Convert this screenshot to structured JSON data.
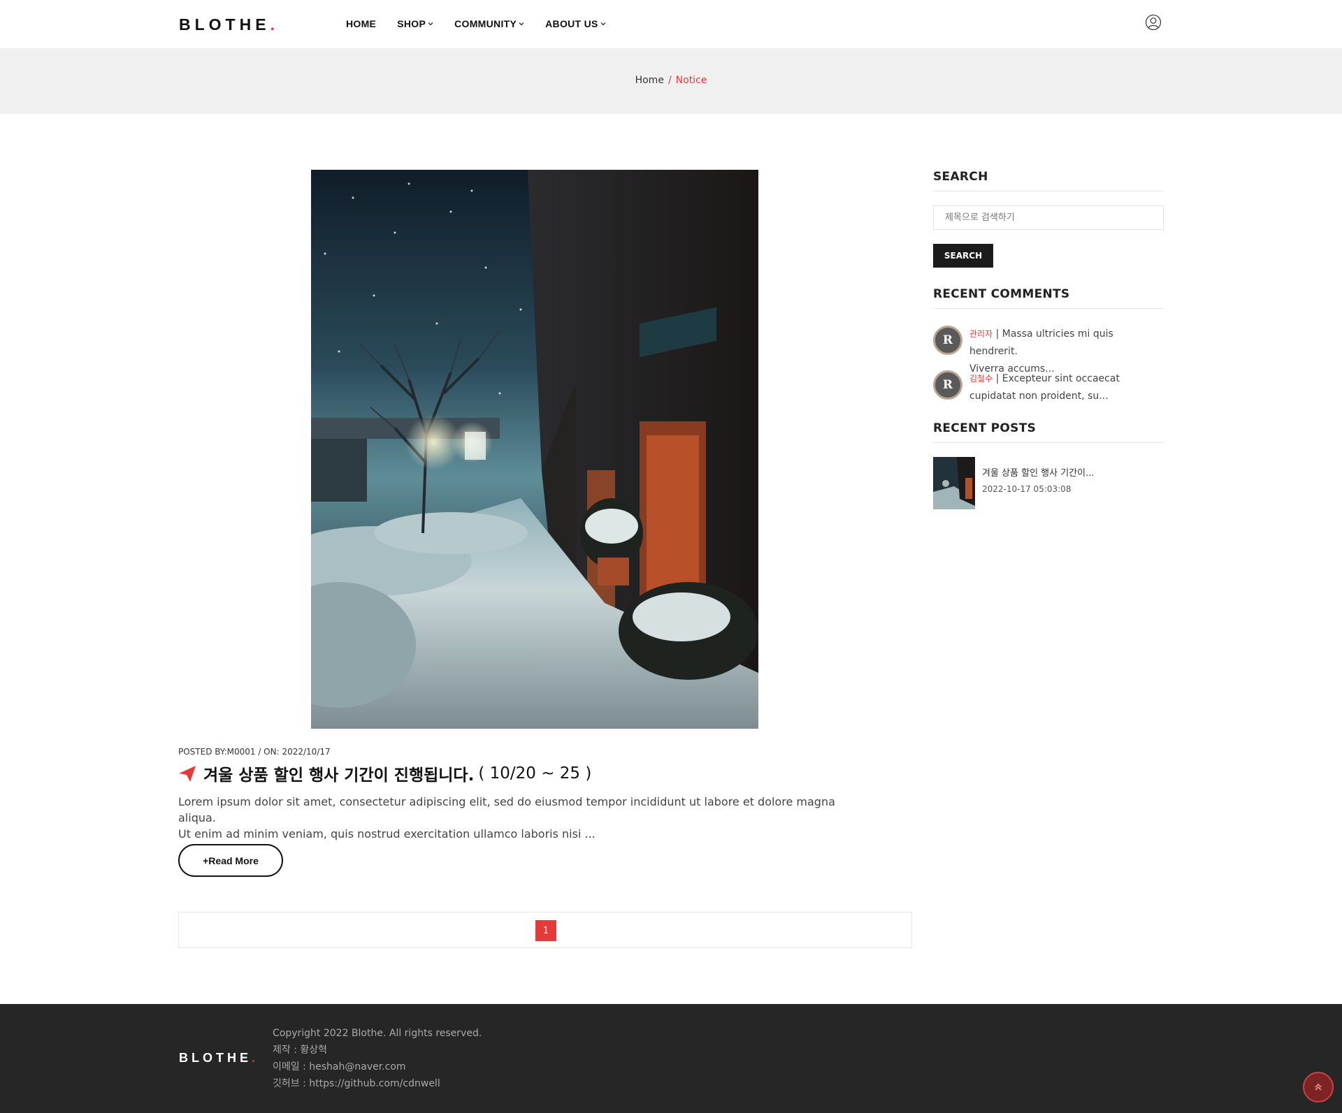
{
  "header": {
    "logo": "BLOTHE",
    "logo_dot": ".",
    "nav": [
      {
        "label": "HOME",
        "dropdown": false
      },
      {
        "label": "SHOP",
        "dropdown": true
      },
      {
        "label": "COMMUNITY",
        "dropdown": true
      },
      {
        "label": "ABOUT US",
        "dropdown": true
      }
    ],
    "user_icon": "user-circle-icon"
  },
  "breadcrumb": {
    "home": "Home",
    "separator": "/",
    "current": "Notice"
  },
  "post": {
    "image": "snowy-street-night-photo",
    "meta": "POSTED BY:M0001 / ON: 2022/10/17",
    "title": "겨울 상품 할인 행사 기간이 진행됩니다.",
    "title_range": "( 10/20 ~ 25 )",
    "title_icon": "paper-plane-icon",
    "excerpt_line1": "Lorem ipsum dolor sit amet, consectetur adipiscing elit, sed do eiusmod tempor incididunt ut labore et dolore magna aliqua.",
    "excerpt_line2": "Ut enim ad minim veniam, quis nostrud exercitation ullamco laboris nisi ...",
    "read_more": "+Read More"
  },
  "pagination": {
    "current_page": "1"
  },
  "sidebar": {
    "search": {
      "title": "SEARCH",
      "placeholder": "제목으로 검색하기",
      "button": "SEARCH"
    },
    "recent_comments": {
      "title": "RECENT COMMENTS",
      "items": [
        {
          "avatar": "R",
          "author": "관리자",
          "sep": " | ",
          "text_line1": "Massa ultricies mi quis hendrerit.",
          "text_line2": "Viverra accums..."
        },
        {
          "avatar": "R",
          "author": "김철수",
          "sep": " | ",
          "text_line1": "Excepteur sint occaecat",
          "text_line2": "cupidatat non proident, su..."
        }
      ]
    },
    "recent_posts": {
      "title": "RECENT POSTS",
      "items": [
        {
          "title": "겨울 상품 할인 행사 기간이...",
          "date": "2022-10-17 05:03:08"
        }
      ]
    }
  },
  "footer": {
    "logo": "BLOTHE",
    "logo_dot": ".",
    "copyright": "Copyright 2022 Blothe. All rights reserved.",
    "maker": "제작 : 황상혁",
    "email": "이메일 : heshah@naver.com",
    "github": "깃허브 : https://github.com/cdnwell"
  },
  "colors": {
    "accent": "#e33b3b",
    "dark": "#1b1b1b",
    "footer_bg": "#262626",
    "band_bg": "#f0f0f0"
  }
}
